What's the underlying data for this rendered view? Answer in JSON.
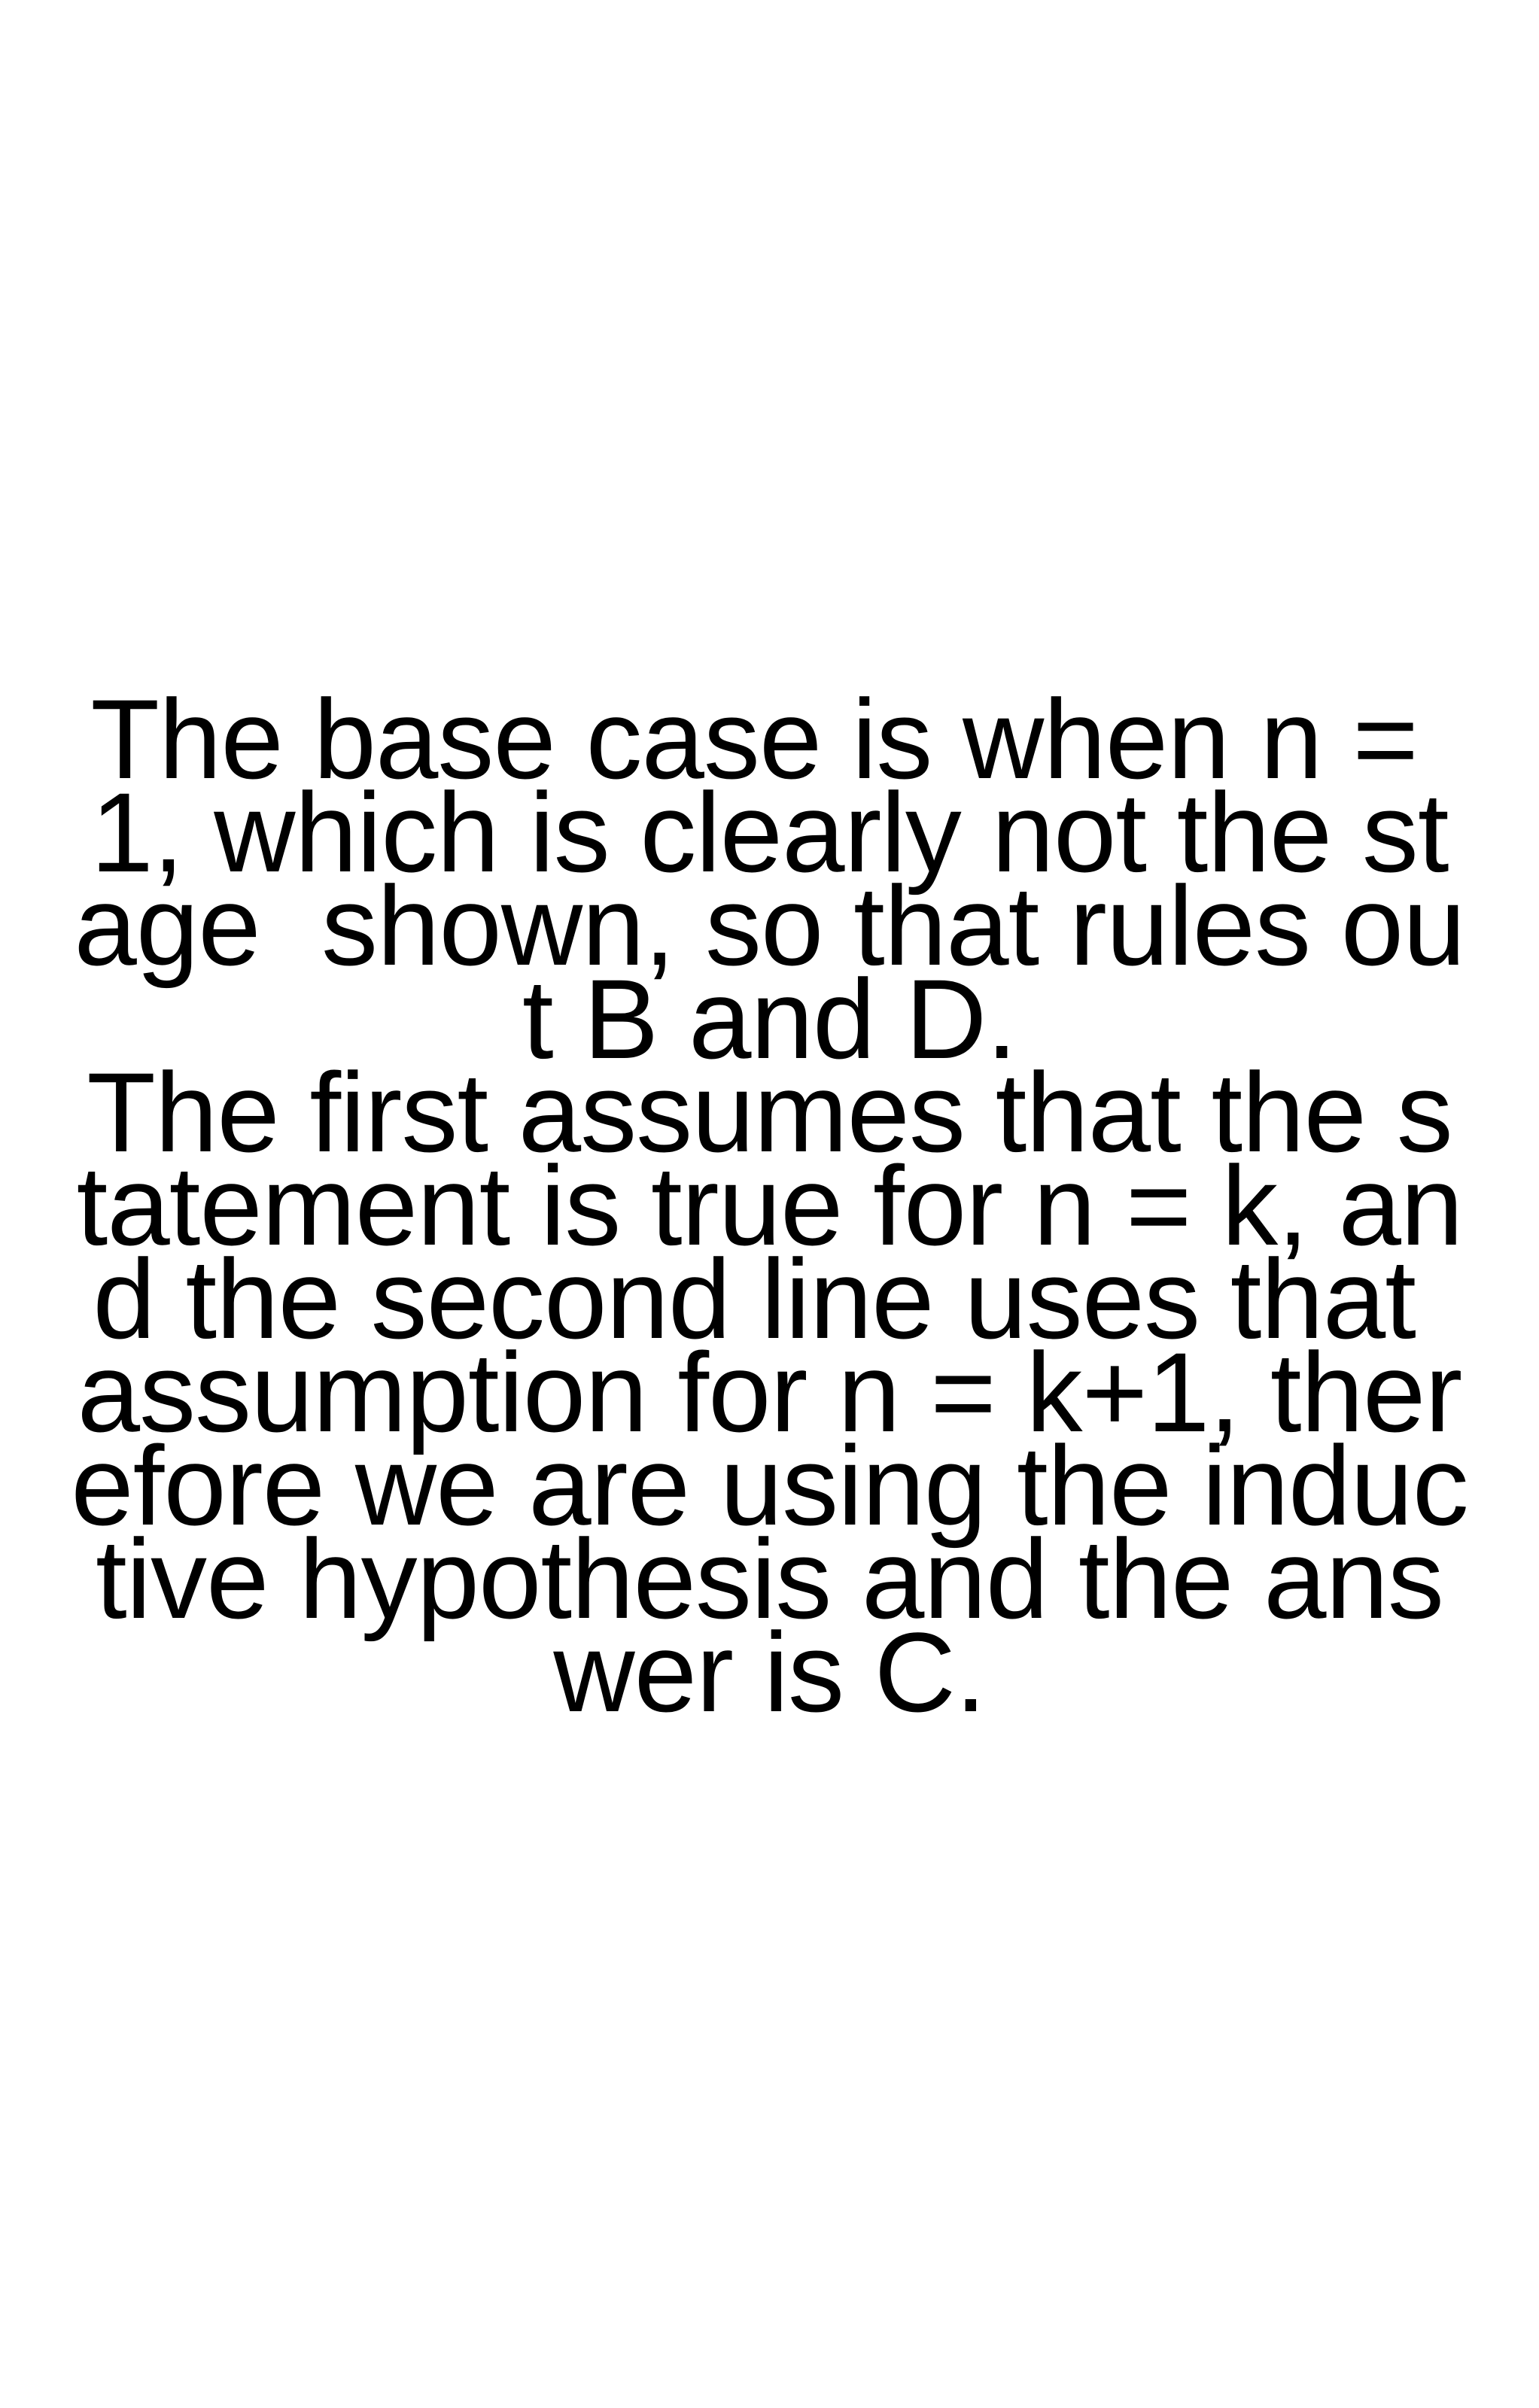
{
  "document": {
    "lines": [
      "The base case is when n = ",
      "1, which is clearly not the st",
      "age  shown, so that rules ou",
      "t B and D.",
      "The first assumes that the s",
      "tatement is true for n = k, an",
      "d the second line uses that ",
      "assumption for n = k+1, ther",
      "efore we are using the induc",
      "tive hypothesis and the ans",
      "wer is C."
    ]
  },
  "colors": {
    "background": "#ffffff",
    "text": "#000000"
  }
}
